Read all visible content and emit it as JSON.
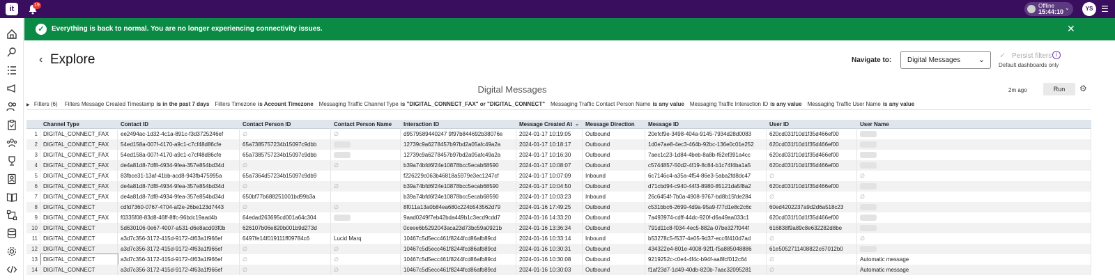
{
  "topbar": {
    "logo": "it",
    "notification_count": "19",
    "status": "Offline",
    "time": "15:44:10",
    "avatar": "YS"
  },
  "banner": {
    "message": "Everything is back to normal. You are no longer experiencing connectivity issues."
  },
  "header": {
    "title": "Explore",
    "navigate_label": "Navigate to:",
    "navigate_value": "Digital Messages",
    "persist_label": "Persist filters",
    "persist_sub": "Default dashboards only"
  },
  "dashboard": {
    "title": "Digital Messages",
    "updated": "2m ago",
    "run_label": "Run"
  },
  "filters": {
    "label": "Filters (6)",
    "items": [
      {
        "text": "Filters Message Created Timestamp",
        "op": "is in the past 7 days"
      },
      {
        "text": "Filters Timezone",
        "op": "is Account Timezone"
      },
      {
        "text": "Messaging Traffic Channel Type",
        "op": "is \"DIGITAL_CONNECT_FAX\" or \"DIGITAL_CONNECT\""
      },
      {
        "text": "Messaging Traffic Contact Person Name",
        "op": "is any value"
      },
      {
        "text": "Messaging Traffic Interaction ID",
        "op": "is any value"
      },
      {
        "text": "Messaging Traffic User Name",
        "op": "is any value"
      }
    ]
  },
  "table": {
    "columns": [
      "Channel Type",
      "Contact ID",
      "Contact Person ID",
      "Contact Person Name",
      "Interaction ID",
      "Message Created At",
      "Message Direction",
      "Message ID",
      "User ID",
      "User Name"
    ],
    "null_symbol": "∅",
    "rows": [
      {
        "n": "1",
        "ch": "DIGITAL_CONNECT_FAX",
        "cid": "ee2494ac-1d32-4c1a-891c-f3d3725246ef",
        "cpid": "∅",
        "cpn": "∅",
        "iid": "d9579589440247 9f97b844692b38076e",
        "at": "2024-01-17 10:19:05",
        "dir": "Outbound",
        "mid": "20efcf9e-3498-404a-9145-7934d28d0083",
        "uid": "620cd031f10d1f35d466ef00",
        "un": "blur"
      },
      {
        "n": "2",
        "ch": "DIGITAL_CONNECT_FAX",
        "cid": "54ed158a-007f-4170-a9c1-c7cf48d86cfe",
        "cpid": "65a7385757234b15097c9dbb",
        "cpn": "blur",
        "iid": "12739c9a6278457b97bd2a05afc49a2a",
        "at": "2024-01-17 10:18:17",
        "dir": "Outbound",
        "mid": "1d0e7ae8-4ec3-464b-92bc-136e0c01e252",
        "uid": "620cd031f10d1f35d466ef00",
        "un": "blur"
      },
      {
        "n": "3",
        "ch": "DIGITAL_CONNECT_FAX",
        "cid": "54ed158a-007f-4170-a9c1-c7cf48d86cfe",
        "cpid": "65a7385757234b15097c9dbb",
        "cpn": "blur",
        "iid": "12739c9a6278457b97bd2a05afc49a2a",
        "at": "2024-01-17 10:16:30",
        "dir": "Outbound",
        "mid": "7aec1c23-1d84-4beb-8a8b-f62ef391a4cc",
        "uid": "620cd031f10d1f35d466ef00",
        "un": "blur"
      },
      {
        "n": "4",
        "ch": "DIGITAL_CONNECT_FAX",
        "cid": "de4a81d8-7df8-4934-9fea-357e854bd34d",
        "cpid": "∅",
        "cpn": "∅",
        "iid": "b39a74bfd6f24e10878bcc5ecab68590",
        "at": "2024-01-17 10:08:07",
        "dir": "Outbound",
        "mid": "c5744857-50d2-4f19-8c84-b1c74f4ba1a5",
        "uid": "620cd031f10d1f35d466ef00",
        "un": "blur"
      },
      {
        "n": "5",
        "ch": "DIGITAL_CONNECT_FAX",
        "cid": "83fbce31-13af-41bb-acd8-943fb475995a",
        "cpid": "65a7364d57234b15097c9db9",
        "cpn": "",
        "iid": "f226229c063b46818a5979e3ec1247cf",
        "at": "2024-01-17 10:07:09",
        "dir": "Inbound",
        "mid": "6c7146c4-a35a-4f54-86e3-5aba2fd8dc47",
        "uid": "∅",
        "un": "∅"
      },
      {
        "n": "6",
        "ch": "DIGITAL_CONNECT_FAX",
        "cid": "de4a81d8-7df8-4934-9fea-357e854bd34d",
        "cpid": "∅",
        "cpn": "∅",
        "iid": "b39a74bfd6f24e10878bcc5ecab68590",
        "at": "2024-01-17 10:04:50",
        "dir": "Outbound",
        "mid": "d71cbd94-c940-44f3-8980-85121da5f8a2",
        "uid": "620cd031f10d1f35d466ef00",
        "un": "blur"
      },
      {
        "n": "7",
        "ch": "DIGITAL_CONNECT_FAX",
        "cid": "de4a81d8-7df8-4934-9fea-357e854bd34d",
        "cpid": "650bf77b688251001bd99b3a",
        "cpn": "",
        "iid": "b39a74bfd6f24e10878bcc5ecab68590",
        "at": "2024-01-17 10:03:23",
        "dir": "Inbound",
        "mid": "26c6454f-7b0a-4908-9767-bd8b15fde284",
        "uid": "∅",
        "un": "∅"
      },
      {
        "n": "8",
        "ch": "DIGITAL_CONNECT",
        "cid": "cdfd7360-0767-4704-af2e-26be123d7443",
        "cpid": "∅",
        "cpn": "∅",
        "iid": "8f011a13a0b84ea680c224b543562d79",
        "at": "2024-01-16 17:49:25",
        "dir": "Outbound",
        "mid": "c531bbc6-2699-4d9a-95a9-f77d1e8c2c6c",
        "uid": "60ed4202237a9d2d6a518c23",
        "un": "blur"
      },
      {
        "n": "9",
        "ch": "DIGITAL_CONNECT_FAX",
        "cid": "f0335f08-83d8-46ff-8ffc-96bdc19aad4b",
        "cpid": "64edad263695cd001a64c304",
        "cpn": "blur",
        "iid": "9aad0249f7eb42bda449b1c3ecd9cdd7",
        "at": "2024-01-16 14:33:20",
        "dir": "Outbound",
        "mid": "7a493974-cdff-44dc-920f-d6a49aa033c1",
        "uid": "620cd031f10d1f35d466ef00",
        "un": "blur"
      },
      {
        "n": "10",
        "ch": "DIGITAL_CONNECT",
        "cid": "5d630106-0e67-4007-a531-d6e8acd03f0b",
        "cpid": "626107b06e820b001b9d273d",
        "cpn": "",
        "iid": "0ceee6b5292043aca23d73bc59a0921b",
        "at": "2024-01-16 13:36:34",
        "dir": "Outbound",
        "mid": "791d11c8-f034-4ec5-882a-07be327f044f",
        "uid": "616838f9a89c8e632282d8be",
        "un": "blur"
      },
      {
        "n": "11",
        "ch": "DIGITAL_CONNECT",
        "cid": "a3d7c356-3172-415d-9172-4f63a1f966ef",
        "cpid": "6497fe14f019111ff09784c6",
        "cpn": "Lucid Marq",
        "iid": "10467c5d5ecc461f8244fcd86afb89cd",
        "at": "2024-01-16 10:33:14",
        "dir": "Inbound",
        "mid": "b53278c5-f537-4e05-9d37-ecc6f410d7ad",
        "uid": "∅",
        "un": "∅"
      },
      {
        "n": "12",
        "ch": "DIGITAL_CONNECT",
        "cid": "a3d7c356-3172-415d-9172-4f63a1f966ef",
        "cpid": "∅",
        "cpn": "∅",
        "iid": "10467c5d5ecc461f8244fcd86afb89cd",
        "at": "2024-01-16 10:30:31",
        "dir": "Outbound",
        "mid": "434322e4-801e-4008-92f1-f5a885048886",
        "uid": "61e5052711408822c67012b0",
        "un": "blur"
      },
      {
        "n": "13",
        "ch": "DIGITAL_CONNECT",
        "cid": "a3d7c356-3172-415d-9172-4f63a1f966ef",
        "cpid": "∅",
        "cpn": "∅",
        "iid": "10467c5d5ecc461f8244fcd86afb89cd",
        "at": "2024-01-16 10:30:08",
        "dir": "Outbound",
        "mid": "9219252c-c0e4-4f4c-b94f-aa8fcf012c64",
        "uid": "∅",
        "un": "Automatic message"
      },
      {
        "n": "14",
        "ch": "DIGITAL_CONNECT",
        "cid": "a3d7c356-3172-415d-9172-4f63a1f966ef",
        "cpid": "∅",
        "cpn": "∅",
        "iid": "10467c5d5ecc461f8244fcd86afb89cd",
        "at": "2024-01-16 10:30:03",
        "dir": "Outbound",
        "mid": "f1af23d7-1d49-40db-820b-7aac32095281",
        "uid": "∅",
        "un": "Automatic message"
      }
    ]
  },
  "sidebar": {
    "icons": [
      "home-icon",
      "explore-icon",
      "list-icon",
      "megaphone-icon",
      "users-icon",
      "clipboard-icon",
      "team-icon",
      "trophy-icon",
      "contact-card-icon",
      "book-icon",
      "workflow-icon",
      "database-icon",
      "settings-cog-icon",
      "code-icon"
    ]
  }
}
